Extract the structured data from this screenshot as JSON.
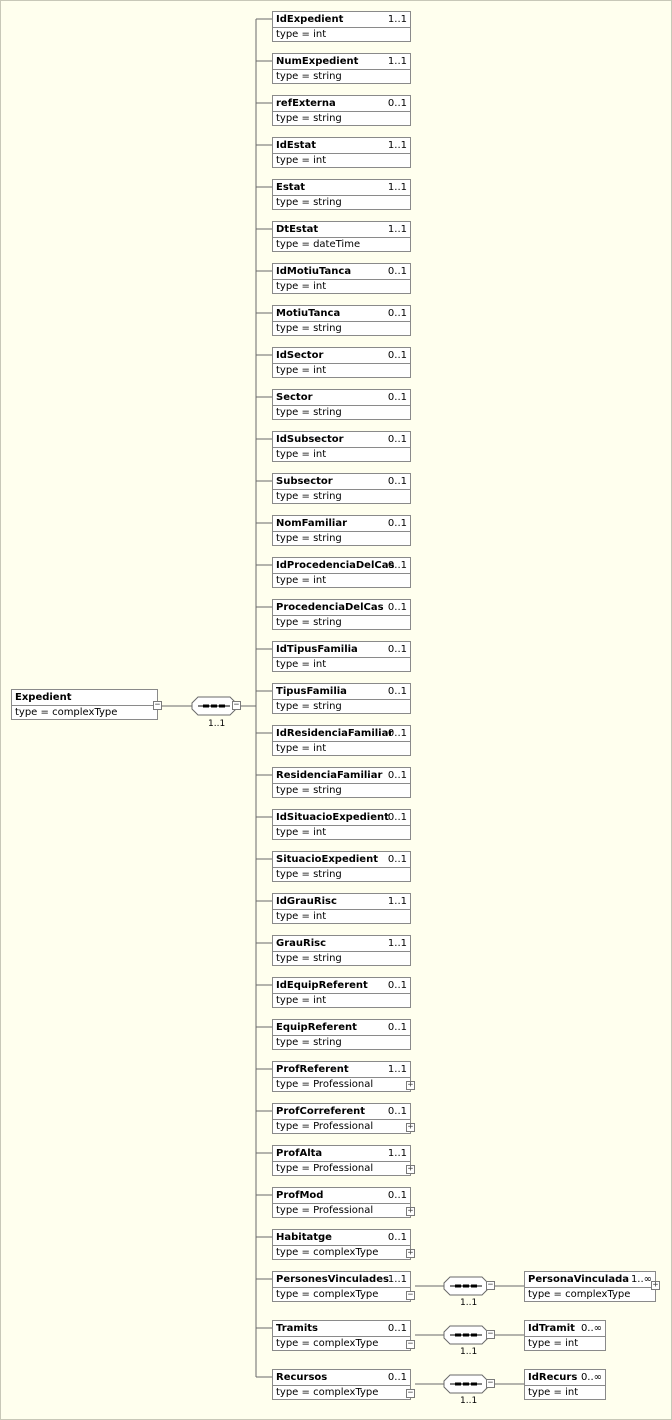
{
  "root": {
    "name": "Expedient",
    "type": "type = complexType"
  },
  "main_sequence": {
    "occurs": "1..1",
    "collapse_symbol": "−",
    "expand_symbol": "+"
  },
  "elements": [
    {
      "name": "IdExpedient",
      "occurs": "1..1",
      "type": "type = int"
    },
    {
      "name": "NumExpedient",
      "occurs": "1..1",
      "type": "type = string"
    },
    {
      "name": "refExterna",
      "occurs": "0..1",
      "type": "type = string"
    },
    {
      "name": "IdEstat",
      "occurs": "1..1",
      "type": "type = int"
    },
    {
      "name": "Estat",
      "occurs": "1..1",
      "type": "type = string"
    },
    {
      "name": "DtEstat",
      "occurs": "1..1",
      "type": "type = dateTime"
    },
    {
      "name": "IdMotiuTanca",
      "occurs": "0..1",
      "type": "type = int"
    },
    {
      "name": "MotiuTanca",
      "occurs": "0..1",
      "type": "type = string"
    },
    {
      "name": "IdSector",
      "occurs": "0..1",
      "type": "type = int"
    },
    {
      "name": "Sector",
      "occurs": "0..1",
      "type": "type = string"
    },
    {
      "name": "IdSubsector",
      "occurs": "0..1",
      "type": "type = int"
    },
    {
      "name": "Subsector",
      "occurs": "0..1",
      "type": "type = string"
    },
    {
      "name": "NomFamiliar",
      "occurs": "0..1",
      "type": "type = string"
    },
    {
      "name": "IdProcedenciaDelCas",
      "occurs": "0..1",
      "type": "type = int"
    },
    {
      "name": "ProcedenciaDelCas",
      "occurs": "0..1",
      "type": "type = string"
    },
    {
      "name": "IdTipusFamilia",
      "occurs": "0..1",
      "type": "type = int"
    },
    {
      "name": "TipusFamilia",
      "occurs": "0..1",
      "type": "type = string"
    },
    {
      "name": "IdResidenciaFamiliar",
      "occurs": "0..1",
      "type": "type = int"
    },
    {
      "name": "ResidenciaFamiliar",
      "occurs": "0..1",
      "type": "type = string"
    },
    {
      "name": "IdSituacioExpedient",
      "occurs": "0..1",
      "type": "type = int"
    },
    {
      "name": "SituacioExpedient",
      "occurs": "0..1",
      "type": "type = string"
    },
    {
      "name": "IdGrauRisc",
      "occurs": "1..1",
      "type": "type = int"
    },
    {
      "name": "GrauRisc",
      "occurs": "1..1",
      "type": "type = string"
    },
    {
      "name": "IdEquipReferent",
      "occurs": "0..1",
      "type": "type = int"
    },
    {
      "name": "EquipReferent",
      "occurs": "0..1",
      "type": "type = string"
    },
    {
      "name": "ProfReferent",
      "occurs": "1..1",
      "type": "type = Professional",
      "toggle": "+"
    },
    {
      "name": "ProfCorreferent",
      "occurs": "0..1",
      "type": "type = Professional",
      "toggle": "+"
    },
    {
      "name": "ProfAlta",
      "occurs": "1..1",
      "type": "type = Professional",
      "toggle": "+"
    },
    {
      "name": "ProfMod",
      "occurs": "0..1",
      "type": "type = Professional",
      "toggle": "+"
    },
    {
      "name": "Habitatge",
      "occurs": "0..1",
      "type": "type = complexType",
      "toggle": "+"
    },
    {
      "name": "PersonesVinculades",
      "occurs": "1..1",
      "type": "type = complexType",
      "toggle": "−",
      "child": {
        "seq_occurs": "1..1",
        "name": "PersonaVinculada",
        "occurs": "1..∞",
        "type": "type = complexType",
        "toggle": "+"
      }
    },
    {
      "name": "Tramits",
      "occurs": "0..1",
      "type": "type = complexType",
      "toggle": "−",
      "child": {
        "seq_occurs": "1..1",
        "name": "IdTramit",
        "occurs": "0..∞",
        "type": "type = int"
      }
    },
    {
      "name": "Recursos",
      "occurs": "0..1",
      "type": "type = complexType",
      "toggle": "−",
      "child": {
        "seq_occurs": "1..1",
        "name": "IdRecurs",
        "occurs": "0..∞",
        "type": "type = int"
      }
    }
  ]
}
